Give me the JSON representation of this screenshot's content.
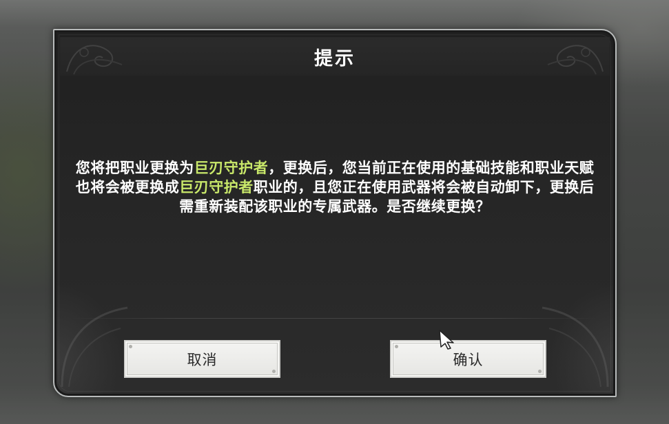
{
  "dialog": {
    "title": "提示",
    "message": {
      "part1": "您将把职业更换为",
      "class_name_1": "巨刃守护者",
      "part2": "，更换后，您当前正在使用的基础技能和职业天赋也将会被更换成",
      "class_name_2": "巨刃守护者",
      "part3": "职业的，且您正在使用武器将会被自动卸下，更换后需重新装配该职业的专属武器。是否继续更换？"
    },
    "highlight_color": "#c9e86a",
    "cancel_label": "取消",
    "confirm_label": "确认"
  },
  "icons": {
    "cursor": "mouse-pointer-icon",
    "title_ornament": "ornament-icon"
  }
}
